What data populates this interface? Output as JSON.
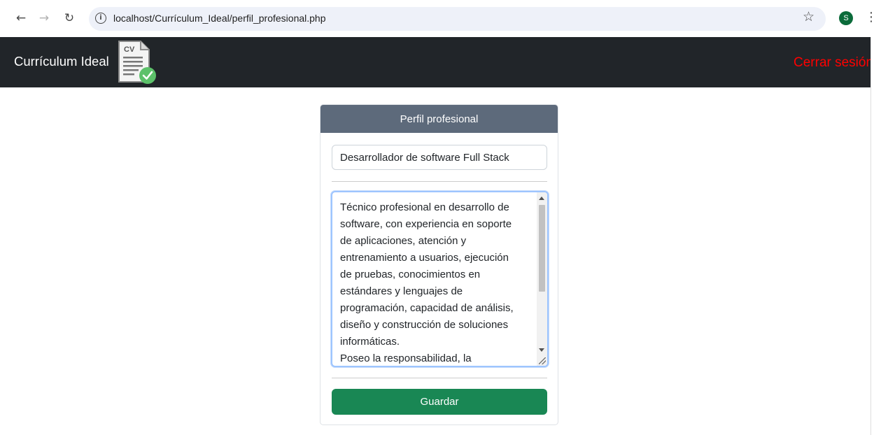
{
  "browser": {
    "back_icon": "arrow-left-icon",
    "forward_icon": "arrow-right-icon",
    "reload_icon": "reload-icon",
    "info_icon": "info-icon",
    "url": "localhost/Currículum_Ideal/perfil_profesional.php",
    "bookmark_icon": "star-icon",
    "profile_initial": "S",
    "menu_icon": "kebab-menu-icon"
  },
  "navbar": {
    "brand": "Currículum Ideal",
    "logo_text": "CV",
    "logout": "Cerrar sesión",
    "logout_color": "#ff0000"
  },
  "card": {
    "header": "Perfil profesional",
    "title_value": "Desarrollador de software Full Stack",
    "summary_text": "Técnico profesional en desarrollo de\nsoftware, con experiencia en soporte\nde aplicaciones, atención y\nentrenamiento a usuarios, ejecución\nde pruebas, conocimientos en\nestándares y lenguajes de\nprogramación, capacidad de análisis,\ndiseño y construcción de soluciones\ninformáticas.\nPoseo la responsabilidad, la",
    "save_label": "Guardar",
    "save_color": "#198754"
  }
}
